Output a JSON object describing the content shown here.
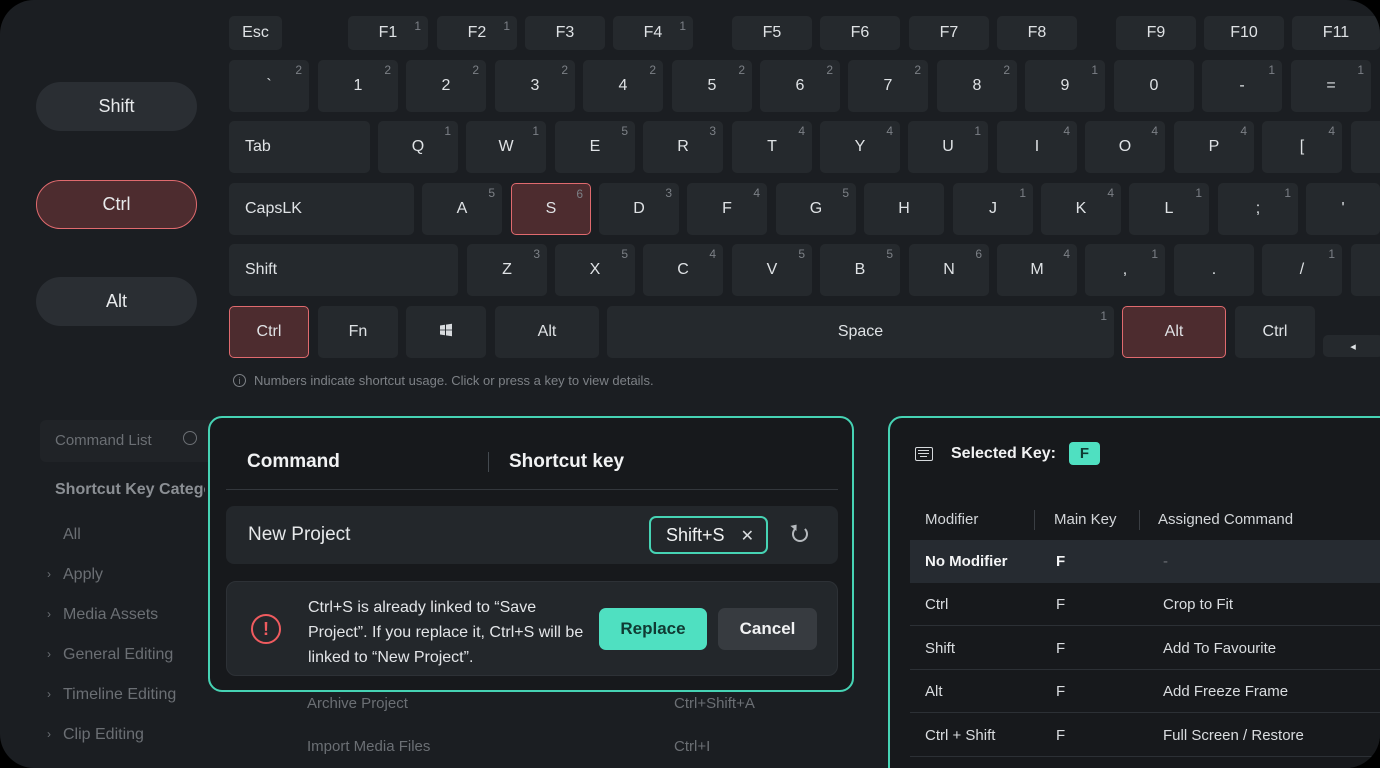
{
  "modifiers": [
    {
      "label": "Shift",
      "active": false
    },
    {
      "label": "Ctrl",
      "active": true
    },
    {
      "label": "Alt",
      "active": false
    }
  ],
  "keyboard": {
    "rows": [
      [
        {
          "label": "Esc",
          "count": ""
        },
        {
          "label": "F1",
          "count": "1"
        },
        {
          "label": "F2",
          "count": "1"
        },
        {
          "label": "F3",
          "count": ""
        },
        {
          "label": "F4",
          "count": "1"
        },
        {
          "label": "F5",
          "count": ""
        },
        {
          "label": "F6",
          "count": ""
        },
        {
          "label": "F7",
          "count": ""
        },
        {
          "label": "F8",
          "count": ""
        },
        {
          "label": "F9",
          "count": ""
        },
        {
          "label": "F10",
          "count": ""
        },
        {
          "label": "F11",
          "count": ""
        }
      ],
      [
        {
          "label": "`",
          "count": "2"
        },
        {
          "label": "1",
          "count": "2"
        },
        {
          "label": "2",
          "count": "2"
        },
        {
          "label": "3",
          "count": "2"
        },
        {
          "label": "4",
          "count": "2"
        },
        {
          "label": "5",
          "count": "2"
        },
        {
          "label": "6",
          "count": "2"
        },
        {
          "label": "7",
          "count": "2"
        },
        {
          "label": "8",
          "count": "2"
        },
        {
          "label": "9",
          "count": "1"
        },
        {
          "label": "0",
          "count": ""
        },
        {
          "label": "-",
          "count": "1"
        },
        {
          "label": "=",
          "count": "1"
        }
      ],
      [
        {
          "label": "Tab",
          "count": ""
        },
        {
          "label": "Q",
          "count": "1"
        },
        {
          "label": "W",
          "count": "1"
        },
        {
          "label": "E",
          "count": "5"
        },
        {
          "label": "R",
          "count": "3"
        },
        {
          "label": "T",
          "count": "4"
        },
        {
          "label": "Y",
          "count": "4"
        },
        {
          "label": "U",
          "count": "1"
        },
        {
          "label": "I",
          "count": "4"
        },
        {
          "label": "O",
          "count": "4"
        },
        {
          "label": "P",
          "count": "4"
        },
        {
          "label": "[",
          "count": "4"
        },
        {
          "label": "",
          "count": ""
        }
      ],
      [
        {
          "label": "CapsLK",
          "count": ""
        },
        {
          "label": "A",
          "count": "5"
        },
        {
          "label": "S",
          "count": "6"
        },
        {
          "label": "D",
          "count": "3"
        },
        {
          "label": "F",
          "count": "4"
        },
        {
          "label": "G",
          "count": "5"
        },
        {
          "label": "H",
          "count": ""
        },
        {
          "label": "J",
          "count": "1"
        },
        {
          "label": "K",
          "count": "4"
        },
        {
          "label": "L",
          "count": "1"
        },
        {
          "label": ";",
          "count": "1"
        },
        {
          "label": "'",
          "count": ""
        }
      ],
      [
        {
          "label": "Shift",
          "count": ""
        },
        {
          "label": "Z",
          "count": "3"
        },
        {
          "label": "X",
          "count": "5"
        },
        {
          "label": "C",
          "count": "4"
        },
        {
          "label": "V",
          "count": "5"
        },
        {
          "label": "B",
          "count": "5"
        },
        {
          "label": "N",
          "count": "6"
        },
        {
          "label": "M",
          "count": "4"
        },
        {
          "label": ",",
          "count": "1"
        },
        {
          "label": ".",
          "count": ""
        },
        {
          "label": "/",
          "count": "1"
        },
        {
          "label": "",
          "count": ""
        }
      ],
      [
        {
          "label": "Ctrl",
          "count": ""
        },
        {
          "label": "Fn",
          "count": ""
        },
        {
          "label": "",
          "count": "",
          "icon": "windows-icon"
        },
        {
          "label": "Alt",
          "count": ""
        },
        {
          "label": "Space",
          "count": "1"
        },
        {
          "label": "Alt",
          "count": ""
        },
        {
          "label": "Ctrl",
          "count": ""
        },
        {
          "label": "◂",
          "count": ""
        }
      ]
    ],
    "active_keys": [
      "3-2",
      "5-0",
      "5-5"
    ],
    "hint": "Numbers indicate shortcut usage. Click or press a key to view details."
  },
  "command_list": {
    "search_placeholder": "Command List",
    "category_title": "Shortcut Key Category",
    "categories": [
      "All",
      "Apply",
      "Media Assets",
      "General Editing",
      "Timeline Editing",
      "Clip Editing"
    ],
    "rows": [
      {
        "command": "Archive Project",
        "shortcut": "Ctrl+Shift+A"
      },
      {
        "command": "Import Media Files",
        "shortcut": "Ctrl+I"
      }
    ]
  },
  "dialog": {
    "header_command": "Command",
    "header_shortcut": "Shortcut key",
    "command": "New Project",
    "shortcut": "Shift+S",
    "clear_glyph": "✕",
    "warning_icon": "!",
    "warning_text": "Ctrl+S is already linked to “Save Project”. If you replace it, Ctrl+S will be linked to “New Project”.",
    "replace_label": "Replace",
    "cancel_label": "Cancel"
  },
  "selected_key": {
    "label": "Selected Key:",
    "key": "F",
    "columns": [
      "Modifier",
      "Main Key",
      "Assigned Command"
    ],
    "rows": [
      {
        "modifier": "No Modifier",
        "key": "F",
        "command": "-"
      },
      {
        "modifier": "Ctrl",
        "key": "F",
        "command": "Crop to Fit"
      },
      {
        "modifier": "Shift",
        "key": "F",
        "command": "Add To Favourite"
      },
      {
        "modifier": "Alt",
        "key": "F",
        "command": "Add Freeze Frame"
      },
      {
        "modifier": "Ctrl + Shift",
        "key": "F",
        "command": "Full Screen / Restore"
      }
    ]
  },
  "colors": {
    "accent": "#46d3b4",
    "active_key_border": "#e06a6e",
    "warning": "#ef5b5f"
  }
}
